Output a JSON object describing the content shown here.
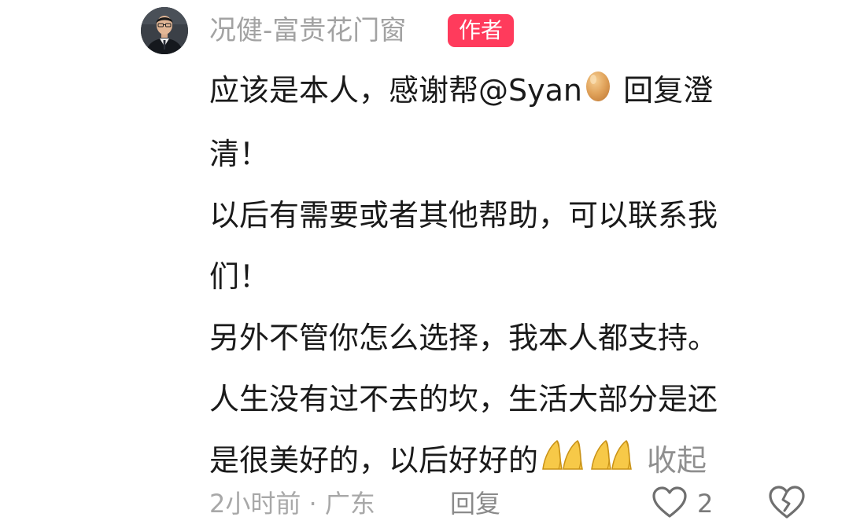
{
  "author": {
    "name": "况健-富贵花门窗",
    "badge": "作者"
  },
  "comment": {
    "line1_before": "应该是本人，感谢帮@Syan",
    "line1_after": " 回复澄",
    "line2": "清！",
    "line3": "以后有需要或者其他帮助，可以联系我",
    "line4": "们！",
    "line5": "另外不管你怎么选择，我本人都支持。",
    "line6": "人生没有过不去的坎，生活大部分是还",
    "line7": "是很美好的，以后好好的",
    "collapse_label": "收起"
  },
  "icons": {
    "mention_emoji": "egg-emoji",
    "end_emoji": "folded-hands-emoji",
    "like": "heart-outline-icon",
    "dislike": "broken-heart-icon"
  },
  "meta": {
    "time_location": "2小时前 · 广东",
    "reply_label": "回复",
    "like_count": "2"
  }
}
